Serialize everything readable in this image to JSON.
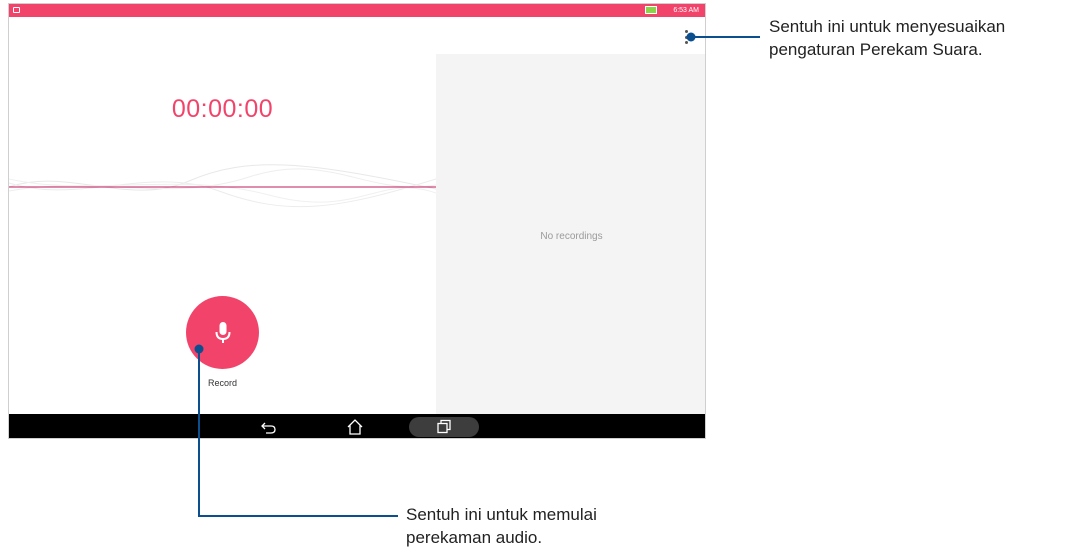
{
  "status_bar": {
    "time": "6:53 AM"
  },
  "recorder": {
    "timer": "00:00:00",
    "record_label": "Record",
    "empty_list_text": "No recordings"
  },
  "callouts": {
    "settings_line1": "Sentuh ini untuk menyesuaikan",
    "settings_line2": "pengaturan Perekam Suara.",
    "record_line1": "Sentuh ini untuk memulai",
    "record_line2": "perekaman audio."
  },
  "icons": {
    "overflow": "more-vert-icon",
    "mic": "microphone-icon",
    "back": "back-icon",
    "home": "home-icon",
    "recents": "recent-apps-icon"
  },
  "colors": {
    "accent": "#f2446b",
    "callout_line": "#0b4f8e",
    "battery": "#8bd448"
  }
}
